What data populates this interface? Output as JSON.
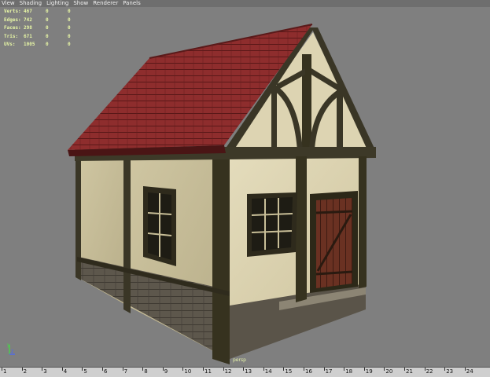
{
  "menu": [
    "View",
    "Shading",
    "Lighting",
    "Show",
    "Renderer",
    "Panels"
  ],
  "hud": [
    {
      "label": "Verts:",
      "v1": "467",
      "v2": "0",
      "v3": "0"
    },
    {
      "label": "Edges:",
      "v1": "742",
      "v2": "0",
      "v3": "0"
    },
    {
      "label": "Faces:",
      "v1": "298",
      "v2": "0",
      "v3": "0"
    },
    {
      "label": "Tris:",
      "v1": "671",
      "v2": "0",
      "v3": "0"
    },
    {
      "label": "UVs:",
      "v1": "1005",
      "v2": "0",
      "v3": "0"
    }
  ],
  "camera_label": "persp",
  "timeline": {
    "ticks": [
      "1",
      "2",
      "3",
      "4",
      "5",
      "6",
      "7",
      "8",
      "9",
      "10",
      "11",
      "12",
      "13",
      "14",
      "15",
      "16",
      "17",
      "18",
      "19",
      "20",
      "21",
      "22",
      "23",
      "24"
    ]
  },
  "colors": {
    "viewport_bg": "#7f7f7f",
    "hud_text": "#e8f7a6",
    "roof": "#8c2b2b",
    "plaster": "#d8cfaa",
    "timber": "#3a3626",
    "stone": "#5a544a",
    "door": "#6a3122"
  }
}
